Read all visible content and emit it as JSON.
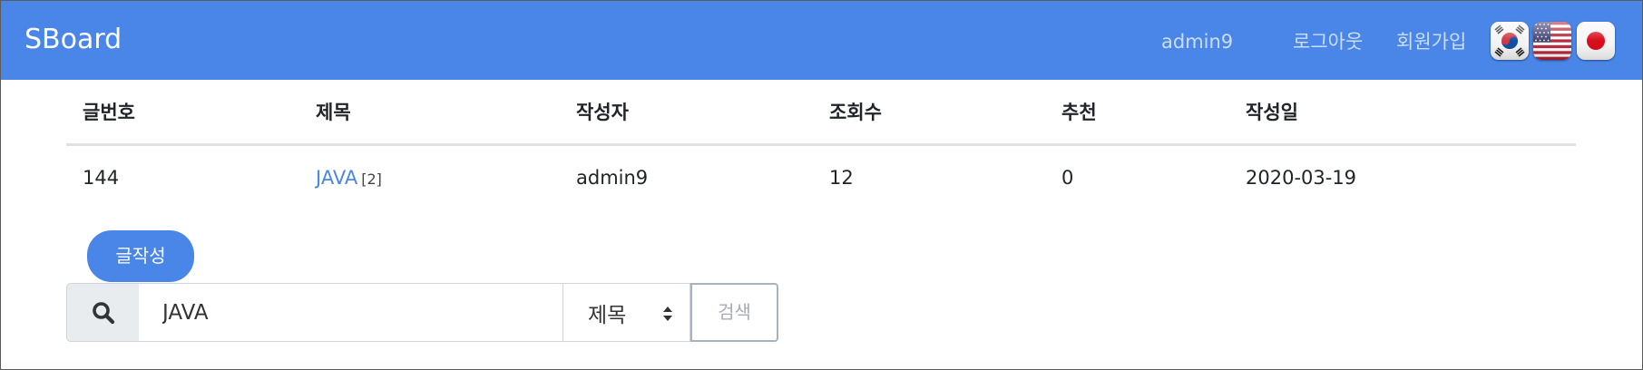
{
  "navbar": {
    "brand": "SBoard",
    "username": "admin9",
    "logout_label": "로그아웃",
    "signup_label": "회원가입",
    "bg_color": "#4a86e8",
    "languages": [
      "korean-flag-icon",
      "usa-flag-icon",
      "japan-flag-icon"
    ]
  },
  "table": {
    "headers": [
      "글번호",
      "제목",
      "작성자",
      "조회수",
      "추천",
      "작성일"
    ],
    "rows": [
      {
        "no": "144",
        "title": "JAVA",
        "reply_count": "[2]",
        "writer": "admin9",
        "hits": "12",
        "recommend": "0",
        "date": "2020-03-19"
      }
    ]
  },
  "actions": {
    "write_label": "글작성"
  },
  "search": {
    "icon": "search-icon",
    "query": "JAVA",
    "field": "제목",
    "button_label": "검색"
  }
}
